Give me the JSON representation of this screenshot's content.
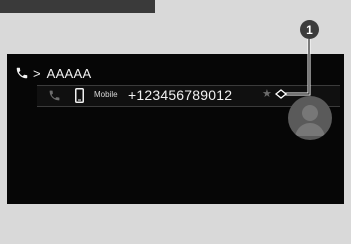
{
  "contact": {
    "name": "AAAAA",
    "breadcrumb_separator": ">",
    "entry": {
      "type_label": "Mobile",
      "number": "+123456789012",
      "favorite": false
    }
  },
  "callout": {
    "number": "1"
  },
  "icons": {
    "call": "phone-icon",
    "mobile": "mobile-phone-icon",
    "favorite": "star-icon",
    "avatar": "contact-avatar-icon"
  },
  "colors": {
    "screen_background": "#060606",
    "page_background": "#d9d9d9",
    "text": "#f2f2f2",
    "divider": "#3b3b3b",
    "avatar_fill": "#5a5a5a"
  }
}
